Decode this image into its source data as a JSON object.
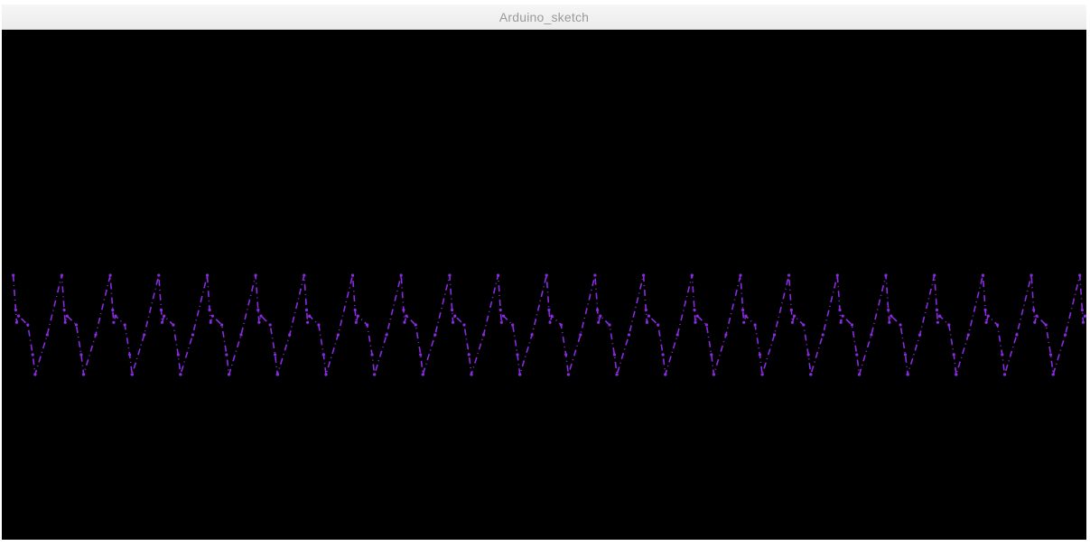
{
  "window": {
    "title": "Arduino_sketch"
  },
  "colors": {
    "canvas_background": "#000000",
    "trace": "#8a2be2",
    "titlebar_text": "#9a9a9a"
  },
  "chart_data": {
    "type": "line",
    "title": "",
    "xlabel": "",
    "ylabel": "",
    "grid": false,
    "legend": "none",
    "style": "dashed-dotted",
    "series": [
      {
        "cycles": 22,
        "samples_per_cycle": [
          0.0,
          0.25,
          0.55,
          0.6,
          0.62,
          0.66,
          0.85,
          0.95,
          1.0
        ],
        "values_per_cycle": [
          -1.0,
          -0.2,
          1.0,
          0.3,
          0.05,
          0.18,
          0.0,
          -0.6,
          -1.0
        ]
      }
    ]
  }
}
